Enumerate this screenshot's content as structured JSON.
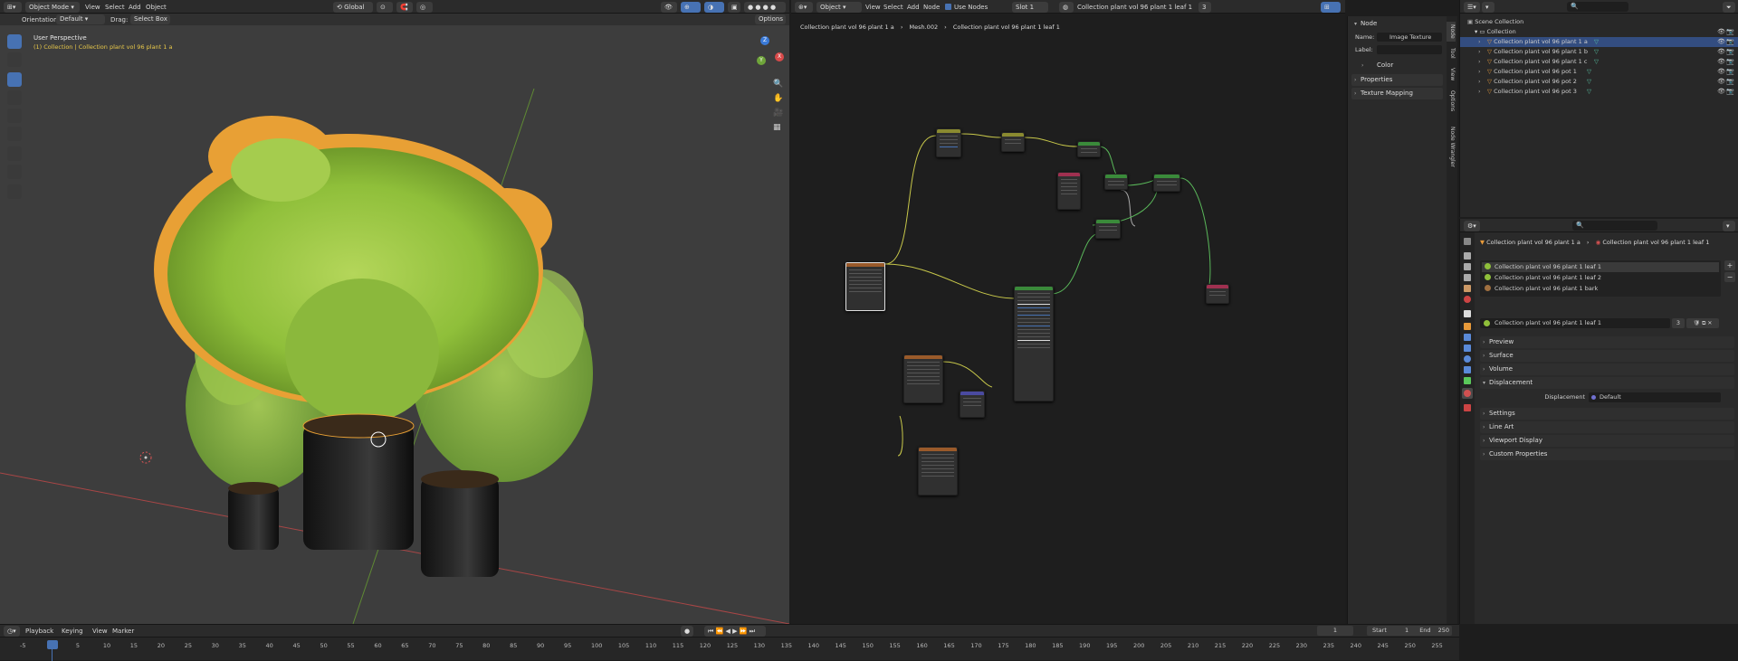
{
  "viewport": {
    "mode": "Object Mode",
    "menus": [
      "View",
      "Select",
      "Add",
      "Object"
    ],
    "transform_space": "Global",
    "orientation_label": "Orientation:",
    "orientation_value": "Default",
    "drag_label": "Drag:",
    "drag_value": "Select Box",
    "options": "Options",
    "perspective": "User Perspective",
    "selection_info": "(1) Collection | Collection plant vol 96 plant 1 a",
    "axis_x": "X",
    "axis_y": "Y",
    "axis_z": "Z"
  },
  "node_editor": {
    "editor_type": "Object",
    "menus": [
      "View",
      "Select",
      "Add",
      "Node"
    ],
    "use_nodes_label": "Use Nodes",
    "slot": "Slot 1",
    "material": "Collection plant vol 96 plant 1 leaf 1",
    "users": "3",
    "breadcrumb": [
      "Collection plant vol 96 plant 1 a",
      "Mesh.002",
      "Collection plant vol 96 plant 1 leaf 1"
    ],
    "sidebar": {
      "section": "Node",
      "name_label": "Name:",
      "name_value": "Image Texture",
      "label_label": "Label:",
      "color_label": "Color",
      "properties_label": "Properties",
      "texture_mapping_label": "Texture Mapping",
      "tabs": [
        "Node",
        "Tool",
        "View",
        "Options",
        "Node Wrangler"
      ]
    }
  },
  "outliner": {
    "scene_collection": "Scene Collection",
    "collection": "Collection",
    "items": [
      {
        "label": "Collection plant vol 96 plant 1 a",
        "selected": true
      },
      {
        "label": "Collection plant vol 96 plant 1 b",
        "selected": false
      },
      {
        "label": "Collection plant vol 96 plant 1 c",
        "selected": false
      },
      {
        "label": "Collection plant vol 96 pot 1",
        "selected": false
      },
      {
        "label": "Collection plant vol 96 pot 2",
        "selected": false
      },
      {
        "label": "Collection plant vol 96 pot 3",
        "selected": false
      }
    ]
  },
  "properties": {
    "breadcrumb_object": "Collection plant vol 96 plant 1 a",
    "breadcrumb_material": "Collection plant vol 96 plant 1 leaf 1",
    "material_slots": [
      "Collection plant vol 96 plant 1 leaf 1",
      "Collection plant vol 96 plant 1 leaf 2",
      "Collection plant vol 96 plant 1 bark"
    ],
    "material_name": "Collection plant vol 96 plant 1 leaf 1",
    "material_users": "3",
    "panels": [
      "Preview",
      "Surface",
      "Volume",
      "Displacement",
      "Settings",
      "Line Art",
      "Viewport Display",
      "Custom Properties"
    ],
    "displacement_label": "Displacement",
    "displacement_value": "Default"
  },
  "timeline": {
    "menus": [
      "Playback",
      "Keying",
      "View",
      "Marker"
    ],
    "current_frame": "1",
    "start_label": "Start",
    "start_value": "1",
    "end_label": "End",
    "end_value": "250",
    "ticks": [
      "-5",
      "1",
      "5",
      "10",
      "15",
      "20",
      "25",
      "30",
      "35",
      "40",
      "45",
      "50",
      "55",
      "60",
      "65",
      "70",
      "75",
      "80",
      "85",
      "90",
      "95",
      "100",
      "105",
      "110",
      "115",
      "120",
      "125",
      "130",
      "135",
      "140",
      "145",
      "150",
      "155",
      "160",
      "165",
      "170",
      "175",
      "180",
      "185",
      "190",
      "195",
      "200",
      "205",
      "210",
      "215",
      "220",
      "225",
      "230",
      "235",
      "240",
      "245",
      "250",
      "255"
    ]
  },
  "colors": {
    "accent": "#4772b3",
    "selection_orange": "#e8a035",
    "leaf_green": "#8fbf3a",
    "x_axis": "#c04a4a",
    "y_axis": "#6f9a3a"
  }
}
